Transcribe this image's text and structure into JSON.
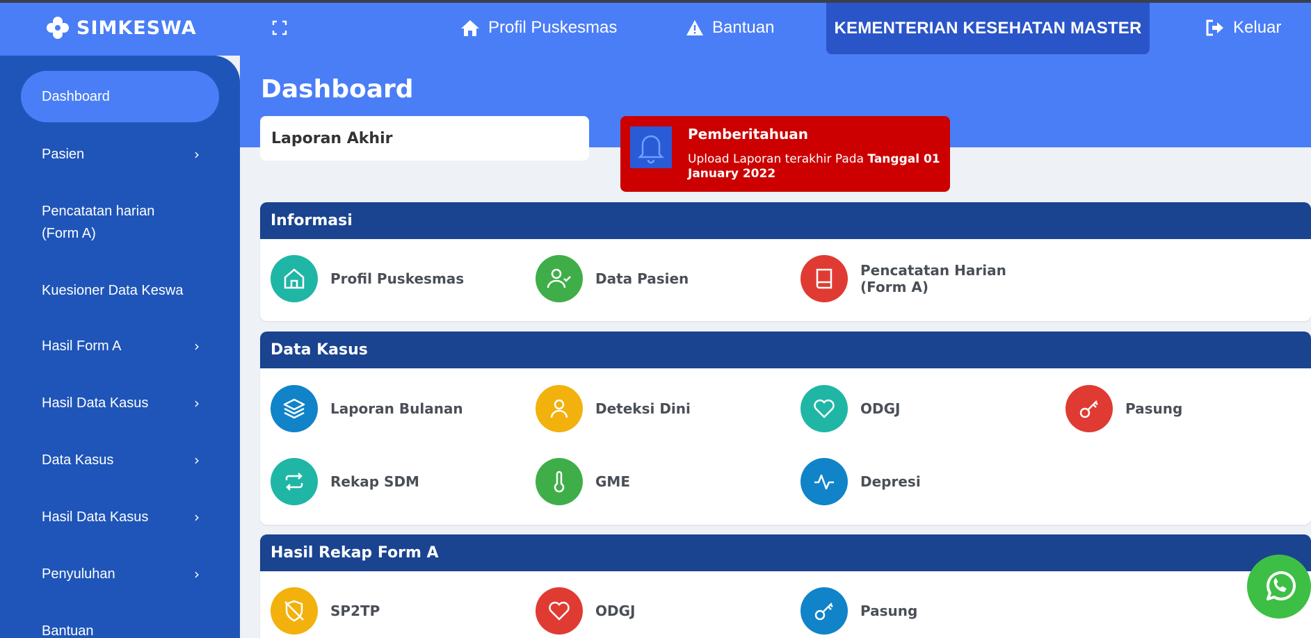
{
  "header": {
    "brand": "SIMKESWA",
    "nav_profil": "Profil Puskesmas",
    "nav_bantuan": "Bantuan",
    "organization": "KEMENTERIAN KESEHATAN MASTER",
    "nav_keluar": "Keluar"
  },
  "sidebar": {
    "items": [
      {
        "label": "Dashboard",
        "chevron": ""
      },
      {
        "label": "Pasien",
        "chevron": "›"
      },
      {
        "label": "Pencatatan harian (Form A)",
        "chevron": ""
      },
      {
        "label": "Kuesioner Data Keswa",
        "chevron": ""
      },
      {
        "label": "Hasil Form A",
        "chevron": "›"
      },
      {
        "label": "Hasil Data Kasus",
        "chevron": "›"
      },
      {
        "label": "Data Kasus",
        "chevron": "›"
      },
      {
        "label": "Hasil Data Kasus",
        "chevron": "›"
      },
      {
        "label": "Penyuluhan",
        "chevron": "›"
      },
      {
        "label": "Bantuan",
        "chevron": ""
      }
    ]
  },
  "main": {
    "title": "Dashboard",
    "report_label": "Laporan Akhir",
    "notification": {
      "title": "Pemberitahuan",
      "text": "Upload Laporan terakhir Pada ",
      "bold": "Tanggal 01 January 2022"
    }
  },
  "sections": {
    "informasi": {
      "title": "Informasi",
      "tiles": [
        "Profil Puskesmas",
        "Data Pasien",
        "Pencatatan Harian (Form A)"
      ]
    },
    "data_kasus": {
      "title": "Data Kasus",
      "tiles": [
        "Laporan Bulanan",
        "Deteksi Dini",
        "ODGJ",
        "Pasung",
        "Rekap SDM",
        "GME",
        "Depresi"
      ]
    },
    "hasil_rekap": {
      "title": "Hasil Rekap Form A",
      "tiles": [
        "SP2TP",
        "ODGJ",
        "Pasung"
      ]
    }
  },
  "colors": {
    "primary": "#4a7ef7",
    "sidebar": "#1f55b8",
    "section_header": "#1a4390",
    "notification": "#cc0000",
    "whatsapp": "#3dbf45"
  }
}
